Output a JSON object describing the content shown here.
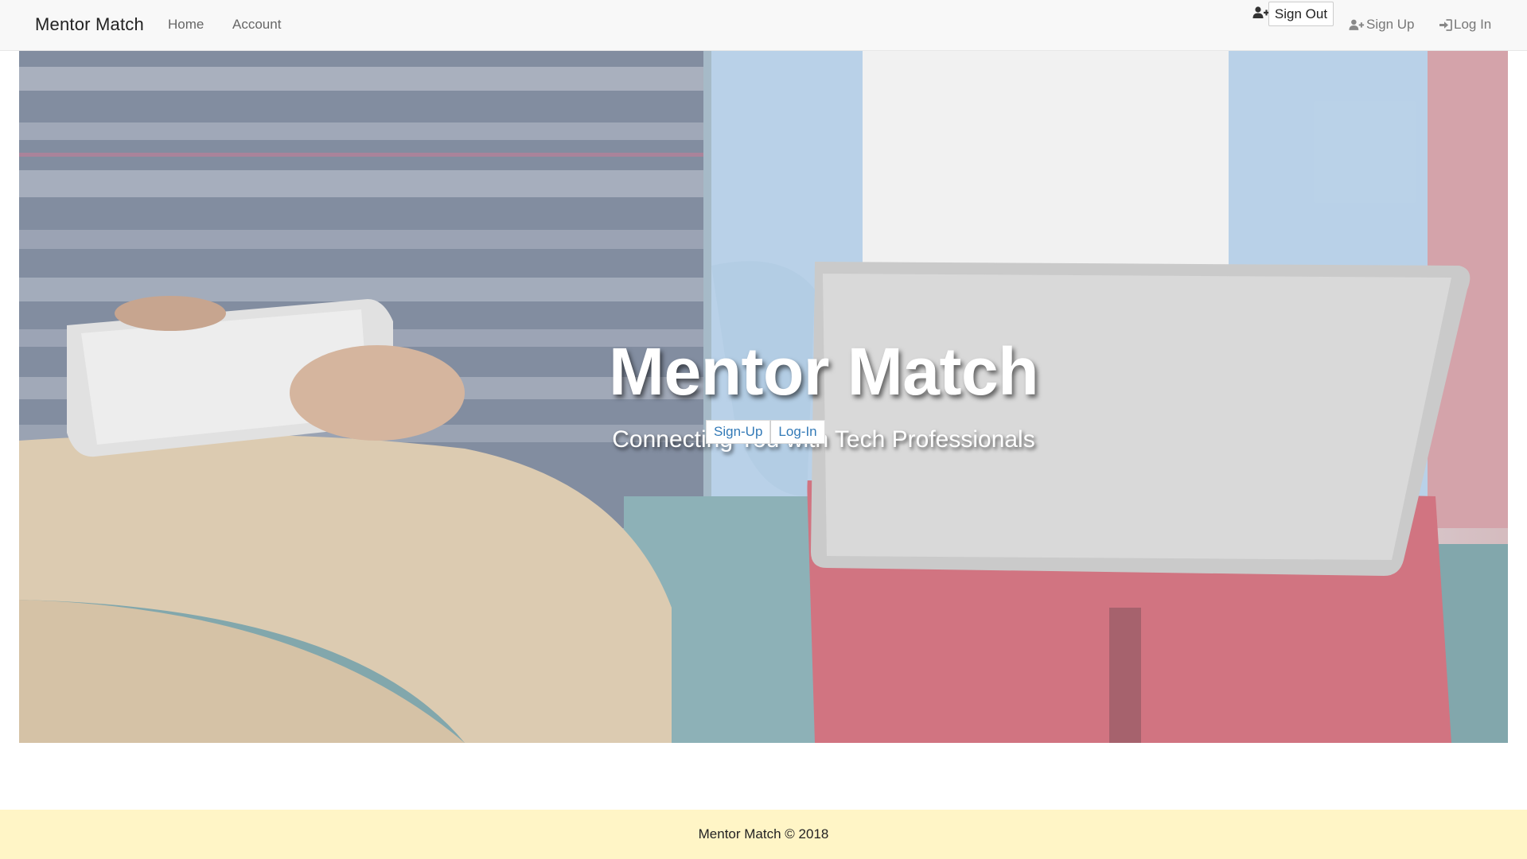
{
  "navbar": {
    "brand": "Mentor Match",
    "links": [
      {
        "label": "Home"
      },
      {
        "label": "Account"
      }
    ],
    "sign_out_label": "Sign Out",
    "sign_up_label": "Sign Up",
    "log_in_label": "Log In"
  },
  "hero": {
    "title": "Mentor Match",
    "subtitle": "Connecting You with Tech Professionals",
    "buttons": [
      {
        "label": "Sign-Up"
      },
      {
        "label": "Log-In"
      }
    ]
  },
  "footer": {
    "text": "Mentor Match © 2018"
  },
  "colors": {
    "navbar_bg": "#f8f8f8",
    "footer_bg": "#fff5c6",
    "link_blue": "#337ab7"
  },
  "icons": {
    "sign_out": "user-plus-icon",
    "sign_up": "user-plus-icon",
    "log_in": "sign-in-icon"
  }
}
